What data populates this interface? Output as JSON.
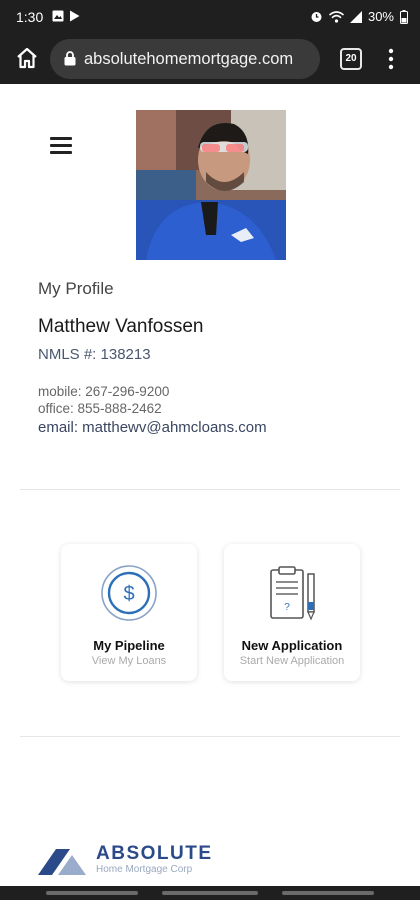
{
  "status": {
    "time": "1:30",
    "battery": "30%"
  },
  "browser": {
    "url": "absolutehomemortgage.com",
    "tab_count": "20"
  },
  "profile": {
    "section_label": "My Profile",
    "name": "Matthew Vanfossen",
    "nmls": "NMLS #: 138213",
    "mobile": "mobile: 267-296-9200",
    "office": "office: 855-888-2462",
    "email": "email: matthewv@ahmcloans.com"
  },
  "actions": [
    {
      "title": "My Pipeline",
      "subtitle": "View My Loans",
      "icon": "dollar-circle-icon"
    },
    {
      "title": "New Application",
      "subtitle": "Start New Application",
      "icon": "clipboard-pencil-icon"
    }
  ],
  "footer": {
    "logo_word": "ABSOLUTE",
    "logo_sub": "Home Mortgage Corp"
  },
  "colors": {
    "brand_blue": "#2b4a8a",
    "accent_blue": "#2d6fb7",
    "chrome_bg": "#1f1f1f"
  }
}
